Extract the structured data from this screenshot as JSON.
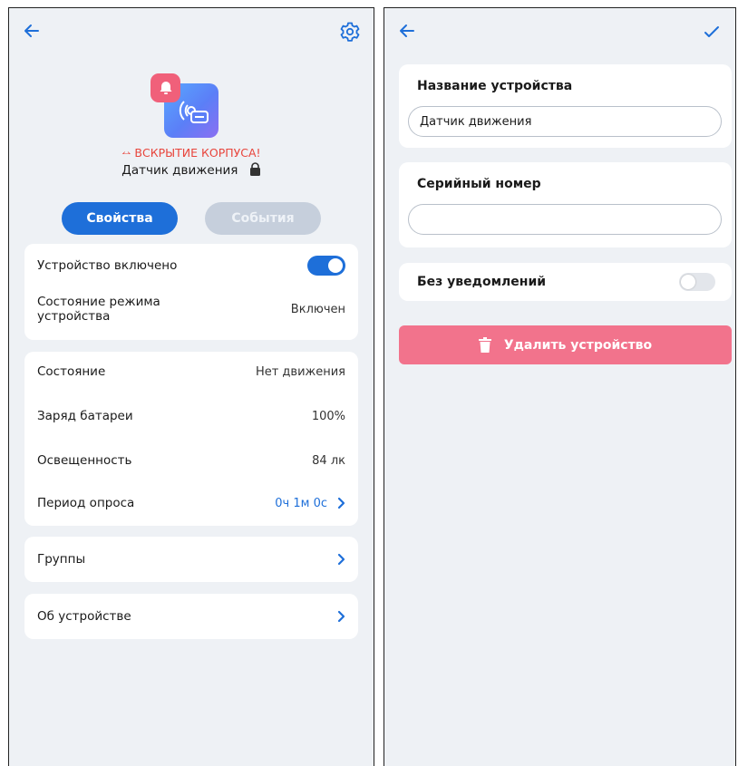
{
  "left": {
    "alert_text": "ВСКРЫТИЕ КОРПУСА!",
    "device_name": "Датчик движения",
    "tabs": {
      "properties": "Свойства",
      "events": "События"
    },
    "status_card": {
      "device_enabled_label": "Устройство включено",
      "device_enabled": true,
      "mode_state_label": "Состояние режима устройства",
      "mode_state_value": "Включен"
    },
    "info_card": {
      "state_label": "Состояние",
      "state_value": "Нет движения",
      "battery_label": "Заряд батареи",
      "battery_value": "100%",
      "illuminance_label": "Освещенность",
      "illuminance_value": "84 лк",
      "poll_label": "Период опроса",
      "poll_value": "0ч 1м 0с"
    },
    "groups_label": "Группы",
    "about_label": "Об устройстве"
  },
  "right": {
    "name_title": "Название устройства",
    "name_value": "Датчик движения",
    "serial_title": "Серийный номер",
    "serial_value": "",
    "no_notifications_label": "Без уведомлений",
    "no_notifications": false,
    "delete_label": "Удалить устройство"
  },
  "colors": {
    "accent": "#1e6fd9",
    "alert": "#e8453c",
    "delete": "#f2738c",
    "background": "#eef1f5"
  },
  "icons": [
    "back-arrow-icon",
    "gear-icon",
    "alarm-bell-icon",
    "motion-sensor-icon",
    "lock-icon",
    "chevron-right-icon",
    "check-icon",
    "trash-icon"
  ]
}
